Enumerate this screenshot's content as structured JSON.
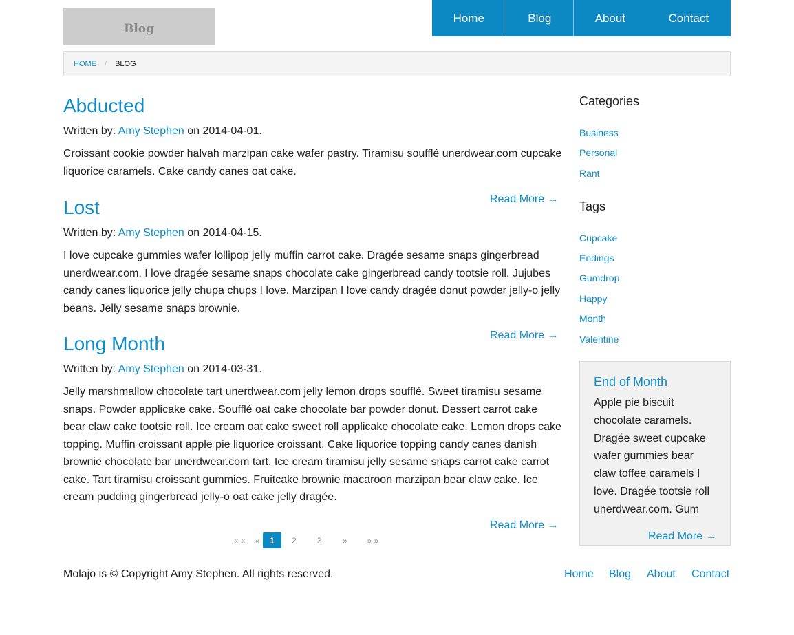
{
  "logo": {
    "text": "Blog"
  },
  "nav": {
    "items": [
      "Home",
      "Blog",
      "About",
      "Contact"
    ]
  },
  "breadcrumb": {
    "home": "HOME",
    "separator": "/",
    "current": "BLOG"
  },
  "posts": [
    {
      "title": "Abducted",
      "by_prefix": "Written by:",
      "author": "Amy Stephen",
      "on_text": "on 2014-04-01.",
      "excerpt": "Croissant cookie powder halvah marzipan cake wafer pastry. Tiramisu soufflé unerdwear.com cupcake liquorice caramels. Cake candy canes oat cake.",
      "read_more": "Read More →"
    },
    {
      "title": "Lost",
      "by_prefix": "Written by:",
      "author": "Amy Stephen",
      "on_text": "on 2014-04-15.",
      "excerpt": "I love cupcake gummies wafer lollipop jelly muffin carrot cake. Dragée sesame snaps gingerbread unerdwear.com. I love dragée sesame snaps chocolate cake gingerbread candy tootsie roll. Jujubes candy canes liquorice jelly chupa chups I love. Marzipan I love candy dragée donut powder jelly-o jelly beans. Jelly sesame snaps brownie.",
      "read_more": "Read More →"
    },
    {
      "title": "Long Month",
      "by_prefix": "Written by:",
      "author": "Amy Stephen",
      "on_text": "on 2014-03-31.",
      "excerpt": "Jelly marshmallow chocolate tart unerdwear.com jelly lemon drops soufflé. Sweet tiramisu sesame snaps. Powder applicake cake. Soufflé oat cake chocolate bar powder donut. Dessert carrot cake bear claw cake tootsie roll. Ice cream oat cake sweet roll applicake chocolate cake. Lemon drops cake topping. Muffin croissant apple pie liquorice croissant. Cake liquorice topping candy canes danish brownie chocolate bar unerdwear.com tart. Ice cream tiramisu jelly sesame snaps carrot cake carrot cake. Tart tiramisu croissant gummies. Fruitcake brownie macaroon marzipan bear claw cake. Ice cream pudding gingerbread jelly-o oat cake jelly dragée.",
      "read_more": "Read More →"
    }
  ],
  "pagination": {
    "first": "« «",
    "prev": "«",
    "pages": [
      "1",
      "2",
      "3"
    ],
    "current": "1",
    "next": "»",
    "last": "» »"
  },
  "sidebar": {
    "categories_title": "Categories",
    "categories": [
      "Business",
      "Personal",
      "Rant"
    ],
    "tags_title": "Tags",
    "tags": [
      "Cupcake",
      "Endings",
      "Gumdrop",
      "Happy",
      "Month",
      "Valentine"
    ],
    "feature": {
      "title": "End of Month",
      "text": "Apple pie biscuit chocolate caramels. Dragée sweet cupcake wafer gummies bear claw toffee caramels I love. Dragée tootsie roll unerdwear.com. Gum",
      "read_more": "Read More →"
    }
  },
  "footer": {
    "copyright": "Molajo is © Copyright Amy Stephen. All rights reserved.",
    "links": [
      "Home",
      "Blog",
      "About",
      "Contact"
    ]
  },
  "colors": {
    "accent": "#0c89c3",
    "link": "#0f8cc7",
    "logo_bg": "#cccccc"
  }
}
